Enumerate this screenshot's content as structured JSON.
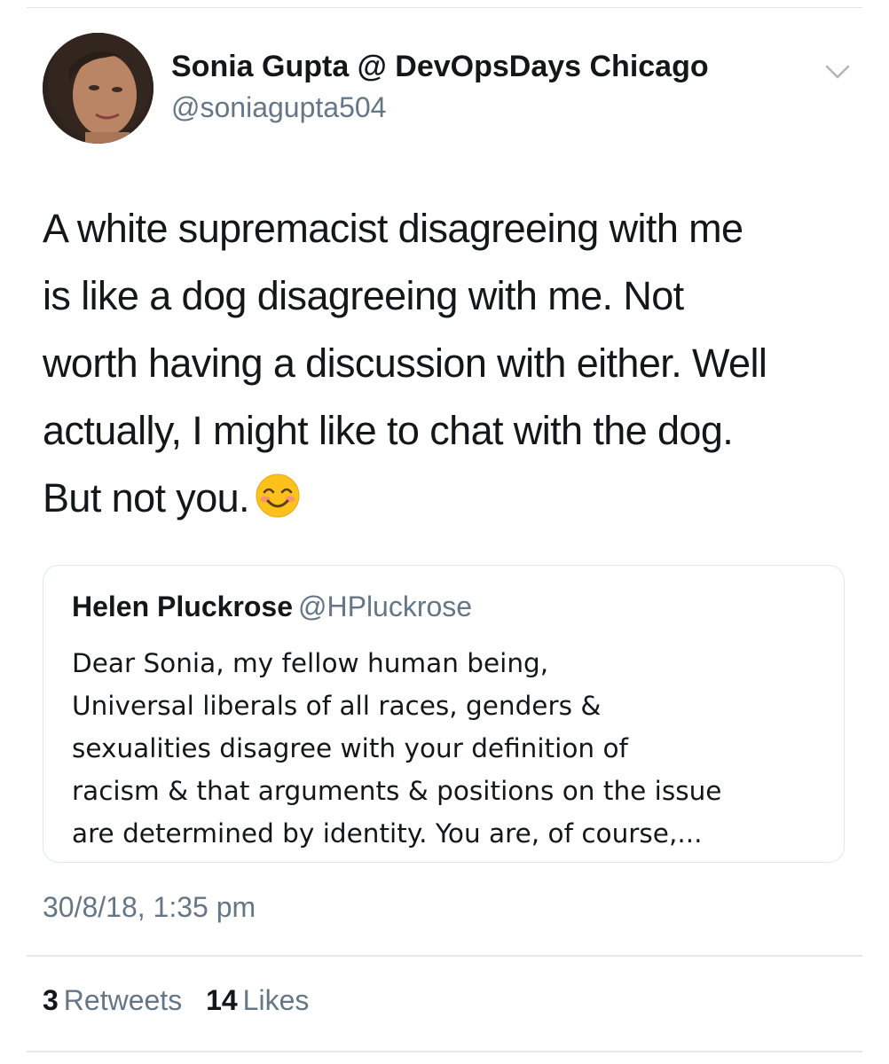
{
  "tweet": {
    "author": {
      "display_name": "Sonia Gupta @ DevOpsDays Chicago",
      "handle": "@soniagupta504"
    },
    "text_lines": [
      "A white supremacist disagreeing with me",
      "is like a dog disagreeing with me. Not",
      "worth having a discussion with either. Well",
      "actually, I might like to chat with the dog.",
      "But not you."
    ],
    "text_emoji": "smiling-face-with-smiling-eyes",
    "quoted_tweet": {
      "display_name": "Helen Pluckrose",
      "handle": "@HPluckrose",
      "text": "Dear Sonia, my fellow human being,\nUniversal liberals of all races, genders &\nsexualities disagree with your definition of\nracism & that arguments & positions on the issue\nare determined by identity. You are, of course,..."
    },
    "timestamp": "30/8/18, 1:35 pm",
    "stats": {
      "retweets_count": "3",
      "retweets_label": "Retweets",
      "likes_count": "14",
      "likes_label": "Likes"
    }
  },
  "icons": {
    "menu_caret": "chevron-down-icon",
    "emoji": "smiling-face-emoji"
  },
  "colors": {
    "text_primary": "#14171a",
    "text_secondary": "#657786",
    "divider": "#e1e8ed",
    "emoji_face": "#fcc21b"
  }
}
